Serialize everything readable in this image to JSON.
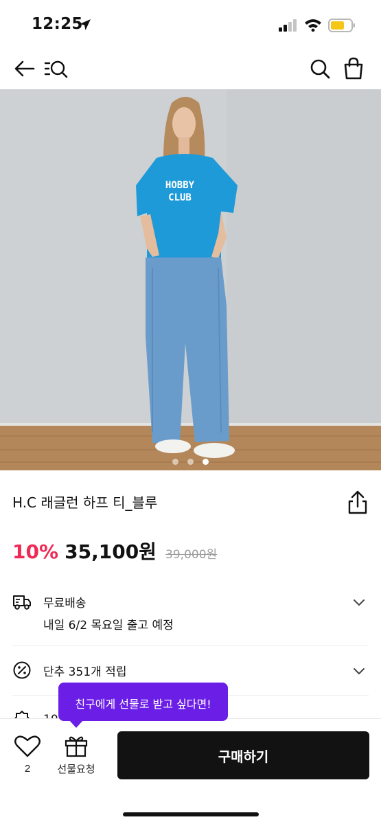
{
  "status_bar": {
    "time": "12:25",
    "icons": [
      "location-arrow-icon",
      "cellular-signal-icon",
      "wifi-icon",
      "battery-icon"
    ],
    "battery_color": "#f5c518"
  },
  "top_nav": {
    "icons": [
      "back-arrow-icon",
      "category-search-icon",
      "search-icon",
      "shopping-bag-icon"
    ]
  },
  "gallery": {
    "image": "model wearing blue HOBBY CLUB t-shirt and light blue wide jeans",
    "shirt_print": [
      "HOBBY",
      "CLUB"
    ],
    "page_count": 3,
    "active_index": 3
  },
  "product": {
    "title": "H.C 래글런 하프 티_블루",
    "discount": "10%",
    "price": "35,100원",
    "original_price": "39,000원",
    "discount_color": "#ef2a55"
  },
  "shipping": {
    "title": "무료배송",
    "detail": "내일 6/2 목요일 출고 예정"
  },
  "points": {
    "title": "단추 351개 적립"
  },
  "next_row": {
    "partial_text": "10"
  },
  "tooltip": {
    "text": "친구에게 선물로 받고 싶다면!",
    "color": "#6b1fe6"
  },
  "bottom_bar": {
    "like_count": "2",
    "gift_label": "선물요청",
    "buy_label": "구매하기"
  }
}
